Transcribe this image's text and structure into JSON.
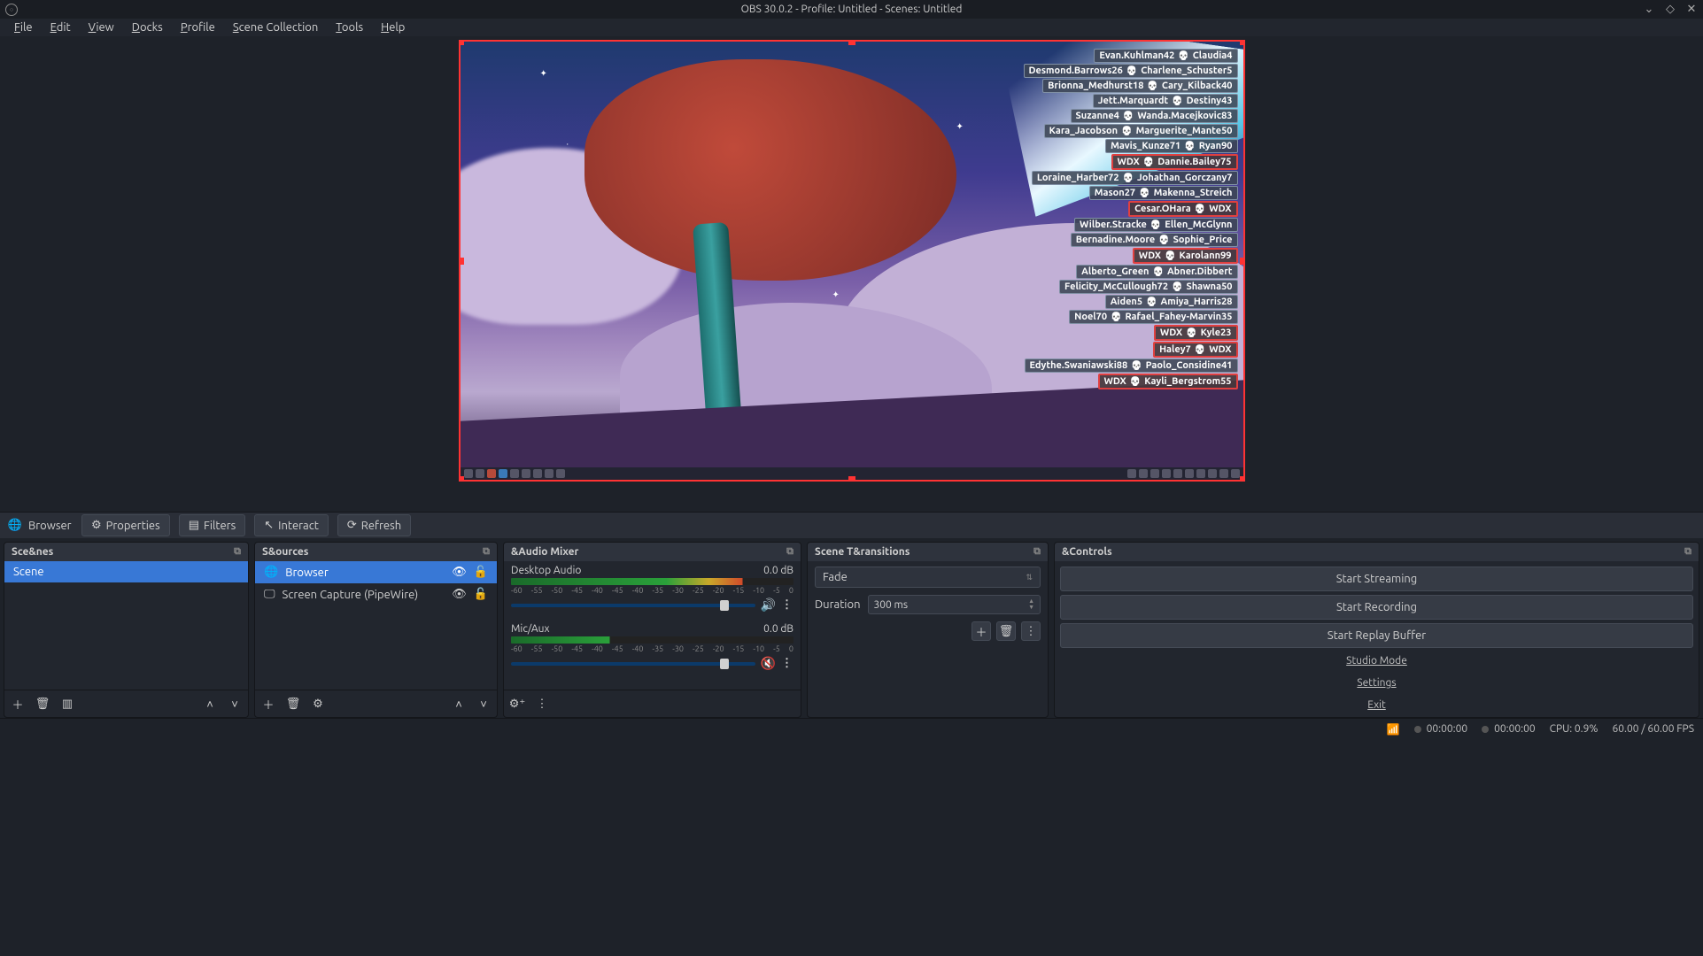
{
  "title": "OBS 30.0.2 - Profile: Untitled - Scenes: Untitled",
  "menu": [
    "File",
    "Edit",
    "View",
    "Docks",
    "Profile",
    "Scene Collection",
    "Tools",
    "Help"
  ],
  "browser_toolbar": {
    "source_label": "Browser",
    "properties": "Properties",
    "filters": "Filters",
    "interact": "Interact",
    "refresh": "Refresh"
  },
  "docks": {
    "scenes": {
      "title": "Sce&nes",
      "items": [
        "Scene"
      ]
    },
    "sources": {
      "title": "S&ources",
      "items": [
        {
          "name": "Browser",
          "selected": true
        },
        {
          "name": "Screen Capture (PipeWire)",
          "selected": false
        }
      ]
    },
    "mixer": {
      "title": "&Audio Mixer",
      "channels": [
        {
          "name": "Desktop Audio",
          "level": "0.0 dB",
          "muted": false
        },
        {
          "name": "Mic/Aux",
          "level": "0.0 dB",
          "muted": true
        }
      ],
      "ticks": [
        "-60",
        "-55",
        "-50",
        "-45",
        "-40",
        "-45",
        "-40",
        "-35",
        "-30",
        "-25",
        "-20",
        "-15",
        "-10",
        "-5",
        "0"
      ]
    },
    "transitions": {
      "title": "Scene T&ransitions",
      "selected": "Fade",
      "duration_label": "Duration",
      "duration_value": "300 ms"
    },
    "controls": {
      "title": "&Controls",
      "buttons": [
        "Start Streaming",
        "Start Recording",
        "Start Replay Buffer"
      ],
      "links": [
        "Studio Mode",
        "Settings",
        "Exit"
      ]
    }
  },
  "kill_feed": [
    {
      "a": "Evan.Kuhlman42",
      "b": "Claudia4",
      "hl": false
    },
    {
      "a": "Desmond.Barrows26",
      "b": "Charlene_Schuster5",
      "hl": false
    },
    {
      "a": "Brionna_Medhurst18",
      "b": "Cary_Kilback40",
      "hl": false
    },
    {
      "a": "Jett.Marquardt",
      "b": "Destiny43",
      "hl": false
    },
    {
      "a": "Suzanne4",
      "b": "Wanda.Macejkovic83",
      "hl": false
    },
    {
      "a": "Kara_Jacobson",
      "b": "Marguerite_Mante50",
      "hl": false
    },
    {
      "a": "Mavis_Kunze71",
      "b": "Ryan90",
      "hl": false
    },
    {
      "a": "WDX",
      "b": "Dannie.Bailey75",
      "hl": true
    },
    {
      "a": "Loraine_Harber72",
      "b": "Johathan_Gorczany7",
      "hl": false
    },
    {
      "a": "Mason27",
      "b": "Makenna_Streich",
      "hl": false
    },
    {
      "a": "Cesar.OHara",
      "b": "WDX",
      "hl": true
    },
    {
      "a": "Wilber.Stracke",
      "b": "Ellen_McGlynn",
      "hl": false
    },
    {
      "a": "Bernadine.Moore",
      "b": "Sophie_Price",
      "hl": false
    },
    {
      "a": "WDX",
      "b": "Karolann99",
      "hl": true
    },
    {
      "a": "Alberto_Green",
      "b": "Abner.Dibbert",
      "hl": false
    },
    {
      "a": "Felicity_McCullough72",
      "b": "Shawna50",
      "hl": false
    },
    {
      "a": "Aiden5",
      "b": "Amiya_Harris28",
      "hl": false
    },
    {
      "a": "Noel70",
      "b": "Rafael_Fahey-Marvin35",
      "hl": false
    },
    {
      "a": "WDX",
      "b": "Kyle23",
      "hl": true
    },
    {
      "a": "Haley7",
      "b": "WDX",
      "hl": true
    },
    {
      "a": "Edythe.Swaniawski88",
      "b": "Paolo_Considine41",
      "hl": false
    },
    {
      "a": "WDX",
      "b": "Kayli_Bergstrom55",
      "hl": true
    }
  ],
  "status": {
    "live_time": "00:00:00",
    "rec_time": "00:00:00",
    "cpu": "CPU: 0.9%",
    "fps": "60.00 / 60.00 FPS"
  }
}
